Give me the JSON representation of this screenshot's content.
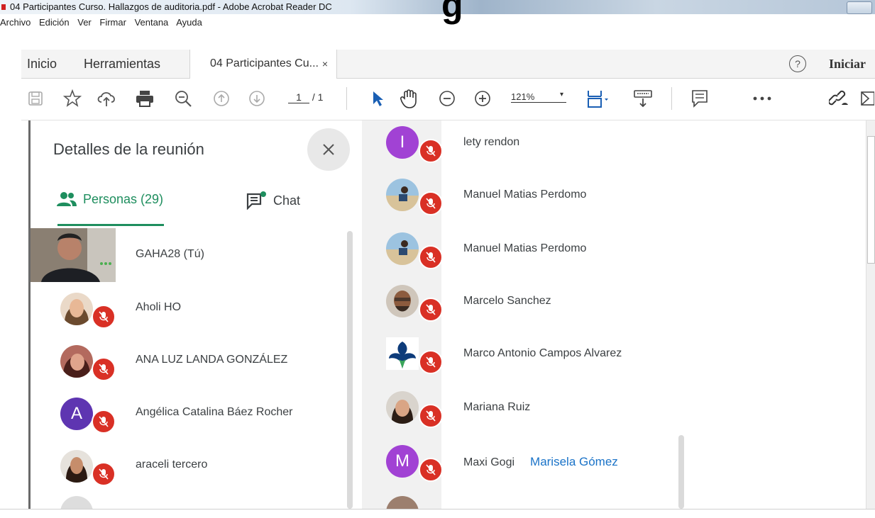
{
  "window": {
    "title": "04 Participantes Curso. Hallazgos de auditoria.pdf - Adobe Acrobat Reader DC"
  },
  "menu": [
    "Archivo",
    "Edición",
    "Ver",
    "Firmar",
    "Ventana",
    "Ayuda"
  ],
  "tabs": {
    "home": "Inicio",
    "tools": "Herramientas",
    "document": "04 Participantes Cu...",
    "close": "×"
  },
  "header": {
    "help": "?",
    "signin": "Iniciar"
  },
  "toolbar": {
    "page_current": "1",
    "page_total": "/ 1",
    "zoom": "121%"
  },
  "panel": {
    "title": "Detalles de la reunión",
    "people_tab": "Personas (29)",
    "chat_tab": "Chat",
    "participants": [
      {
        "name": "GAHA28 (Tú)",
        "avatar": "photo"
      },
      {
        "name": "Aholi HO",
        "avatar": "photo"
      },
      {
        "name": "ANA LUZ LANDA GONZÁLEZ",
        "avatar": "photo"
      },
      {
        "name": "Angélica Catalina Báez Rocher",
        "avatar": "letter",
        "letter": "A",
        "color": "#5e35b1"
      },
      {
        "name": "araceli tercero",
        "avatar": "photo"
      }
    ]
  },
  "right_list": {
    "participants": [
      {
        "name": "lety rendon",
        "avatar": "letter",
        "letter": "I",
        "color": "#a142d4"
      },
      {
        "name": "Manuel Matias Perdomo",
        "avatar": "photo"
      },
      {
        "name": "Manuel Matias Perdomo",
        "avatar": "photo"
      },
      {
        "name": "Marcelo Sanchez",
        "avatar": "photo"
      },
      {
        "name": "Marco Antonio Campos Alvarez",
        "avatar": "logo"
      },
      {
        "name": "Mariana Ruiz",
        "avatar": "photo"
      },
      {
        "name": "Maxi Gogi",
        "avatar": "letter",
        "letter": "M",
        "color": "#a142d4",
        "cursor_label": "Marisela Gómez"
      }
    ]
  },
  "colors": {
    "accent_green": "#1e8e5e",
    "mic_red": "#d93025",
    "link_blue": "#1a73c8"
  }
}
